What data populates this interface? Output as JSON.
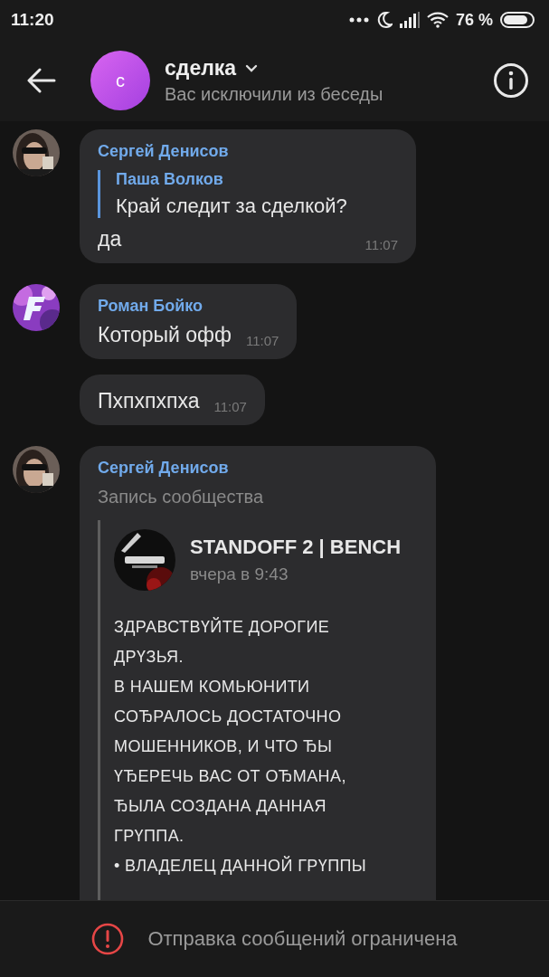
{
  "status_bar": {
    "time": "11:20",
    "battery": "76 %"
  },
  "header": {
    "avatar_letter": "с",
    "title": "сделка",
    "subtitle": "Вас исключили из беседы"
  },
  "messages": [
    {
      "kind": "reply",
      "author": "Сергей Денисов",
      "reply": {
        "author": "Паша Волков",
        "text": "Край следит за сделкой?"
      },
      "text": "да",
      "time": "11:07"
    },
    {
      "kind": "text",
      "avatar": {
        "kind": "logo"
      },
      "author": "Роман Бойко",
      "text": "Который офф",
      "time": "11:07"
    },
    {
      "kind": "text",
      "text": "Пхпхпхпха",
      "time": "11:07"
    },
    {
      "kind": "post",
      "author": "Сергей Денисов",
      "label": "Запись сообщества",
      "post": {
        "name": "STANDOFF 2 | BENCH",
        "date": "вчера в 9:43",
        "paragraphs": [
          "ЗДРАВСТВҮЙТЕ ДОРОГИЕ ДРҮЗЬЯ.",
          "В НАШЕМ КОМЬЮНИТИ СОЂРАЛОСЬ ДОСТАТОЧНО МОШЕННИКОВ, И ЧТО ЂЫ ҮЂЕРЕЧЬ ВАС ОТ ОЂМАНА, ЂЫЛА СОЗДАНА ДАННАЯ ГРҮППА.",
          "• ВЛАДЕЛЕЦ ДАННОЙ ГРҮППЫ"
        ]
      }
    }
  ],
  "footer": {
    "text": "Отправка сообщений ограничена"
  }
}
